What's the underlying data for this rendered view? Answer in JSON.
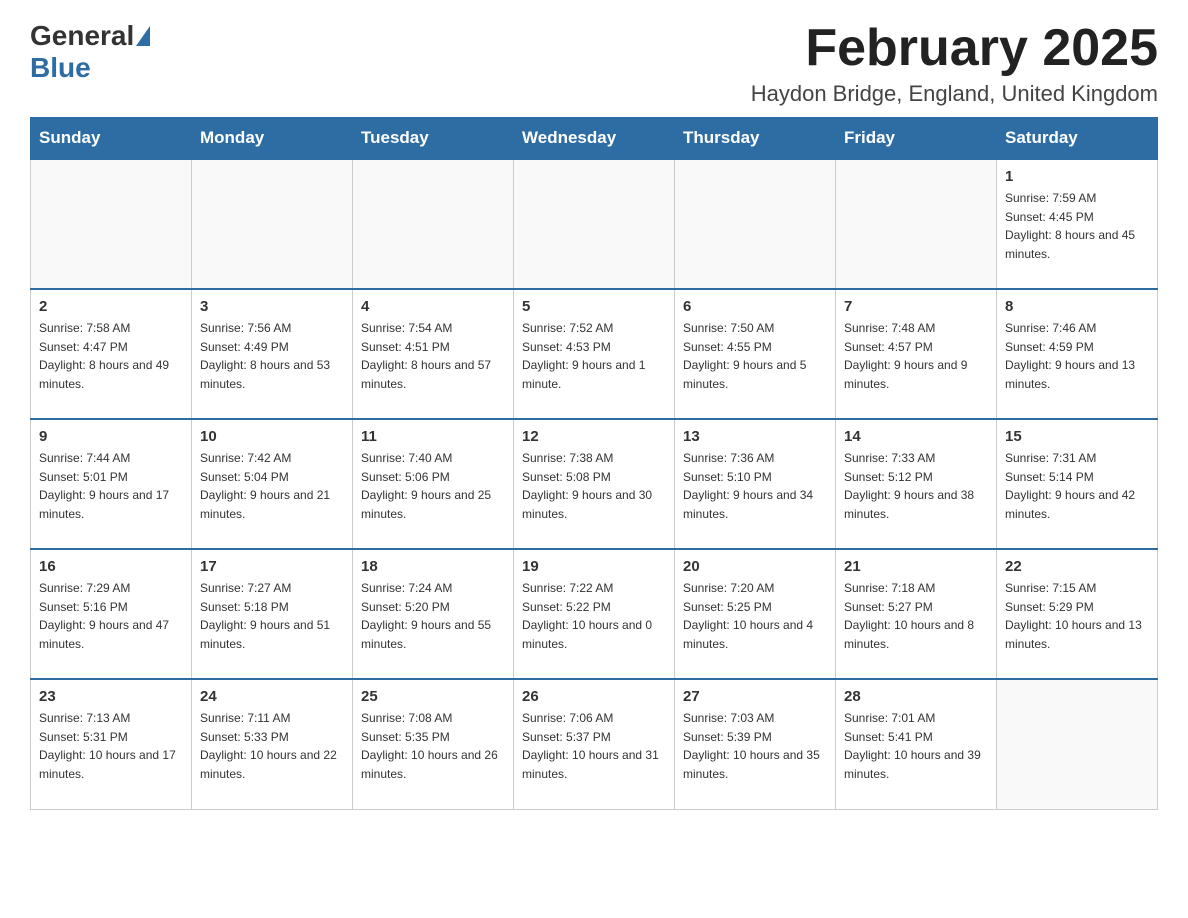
{
  "header": {
    "logo_text_general": "General",
    "logo_text_blue": "Blue",
    "month_title": "February 2025",
    "location": "Haydon Bridge, England, United Kingdom"
  },
  "days_of_week": [
    "Sunday",
    "Monday",
    "Tuesday",
    "Wednesday",
    "Thursday",
    "Friday",
    "Saturday"
  ],
  "weeks": [
    [
      {
        "day": "",
        "info": ""
      },
      {
        "day": "",
        "info": ""
      },
      {
        "day": "",
        "info": ""
      },
      {
        "day": "",
        "info": ""
      },
      {
        "day": "",
        "info": ""
      },
      {
        "day": "",
        "info": ""
      },
      {
        "day": "1",
        "info": "Sunrise: 7:59 AM\nSunset: 4:45 PM\nDaylight: 8 hours and 45 minutes."
      }
    ],
    [
      {
        "day": "2",
        "info": "Sunrise: 7:58 AM\nSunset: 4:47 PM\nDaylight: 8 hours and 49 minutes."
      },
      {
        "day": "3",
        "info": "Sunrise: 7:56 AM\nSunset: 4:49 PM\nDaylight: 8 hours and 53 minutes."
      },
      {
        "day": "4",
        "info": "Sunrise: 7:54 AM\nSunset: 4:51 PM\nDaylight: 8 hours and 57 minutes."
      },
      {
        "day": "5",
        "info": "Sunrise: 7:52 AM\nSunset: 4:53 PM\nDaylight: 9 hours and 1 minute."
      },
      {
        "day": "6",
        "info": "Sunrise: 7:50 AM\nSunset: 4:55 PM\nDaylight: 9 hours and 5 minutes."
      },
      {
        "day": "7",
        "info": "Sunrise: 7:48 AM\nSunset: 4:57 PM\nDaylight: 9 hours and 9 minutes."
      },
      {
        "day": "8",
        "info": "Sunrise: 7:46 AM\nSunset: 4:59 PM\nDaylight: 9 hours and 13 minutes."
      }
    ],
    [
      {
        "day": "9",
        "info": "Sunrise: 7:44 AM\nSunset: 5:01 PM\nDaylight: 9 hours and 17 minutes."
      },
      {
        "day": "10",
        "info": "Sunrise: 7:42 AM\nSunset: 5:04 PM\nDaylight: 9 hours and 21 minutes."
      },
      {
        "day": "11",
        "info": "Sunrise: 7:40 AM\nSunset: 5:06 PM\nDaylight: 9 hours and 25 minutes."
      },
      {
        "day": "12",
        "info": "Sunrise: 7:38 AM\nSunset: 5:08 PM\nDaylight: 9 hours and 30 minutes."
      },
      {
        "day": "13",
        "info": "Sunrise: 7:36 AM\nSunset: 5:10 PM\nDaylight: 9 hours and 34 minutes."
      },
      {
        "day": "14",
        "info": "Sunrise: 7:33 AM\nSunset: 5:12 PM\nDaylight: 9 hours and 38 minutes."
      },
      {
        "day": "15",
        "info": "Sunrise: 7:31 AM\nSunset: 5:14 PM\nDaylight: 9 hours and 42 minutes."
      }
    ],
    [
      {
        "day": "16",
        "info": "Sunrise: 7:29 AM\nSunset: 5:16 PM\nDaylight: 9 hours and 47 minutes."
      },
      {
        "day": "17",
        "info": "Sunrise: 7:27 AM\nSunset: 5:18 PM\nDaylight: 9 hours and 51 minutes."
      },
      {
        "day": "18",
        "info": "Sunrise: 7:24 AM\nSunset: 5:20 PM\nDaylight: 9 hours and 55 minutes."
      },
      {
        "day": "19",
        "info": "Sunrise: 7:22 AM\nSunset: 5:22 PM\nDaylight: 10 hours and 0 minutes."
      },
      {
        "day": "20",
        "info": "Sunrise: 7:20 AM\nSunset: 5:25 PM\nDaylight: 10 hours and 4 minutes."
      },
      {
        "day": "21",
        "info": "Sunrise: 7:18 AM\nSunset: 5:27 PM\nDaylight: 10 hours and 8 minutes."
      },
      {
        "day": "22",
        "info": "Sunrise: 7:15 AM\nSunset: 5:29 PM\nDaylight: 10 hours and 13 minutes."
      }
    ],
    [
      {
        "day": "23",
        "info": "Sunrise: 7:13 AM\nSunset: 5:31 PM\nDaylight: 10 hours and 17 minutes."
      },
      {
        "day": "24",
        "info": "Sunrise: 7:11 AM\nSunset: 5:33 PM\nDaylight: 10 hours and 22 minutes."
      },
      {
        "day": "25",
        "info": "Sunrise: 7:08 AM\nSunset: 5:35 PM\nDaylight: 10 hours and 26 minutes."
      },
      {
        "day": "26",
        "info": "Sunrise: 7:06 AM\nSunset: 5:37 PM\nDaylight: 10 hours and 31 minutes."
      },
      {
        "day": "27",
        "info": "Sunrise: 7:03 AM\nSunset: 5:39 PM\nDaylight: 10 hours and 35 minutes."
      },
      {
        "day": "28",
        "info": "Sunrise: 7:01 AM\nSunset: 5:41 PM\nDaylight: 10 hours and 39 minutes."
      },
      {
        "day": "",
        "info": ""
      }
    ]
  ]
}
